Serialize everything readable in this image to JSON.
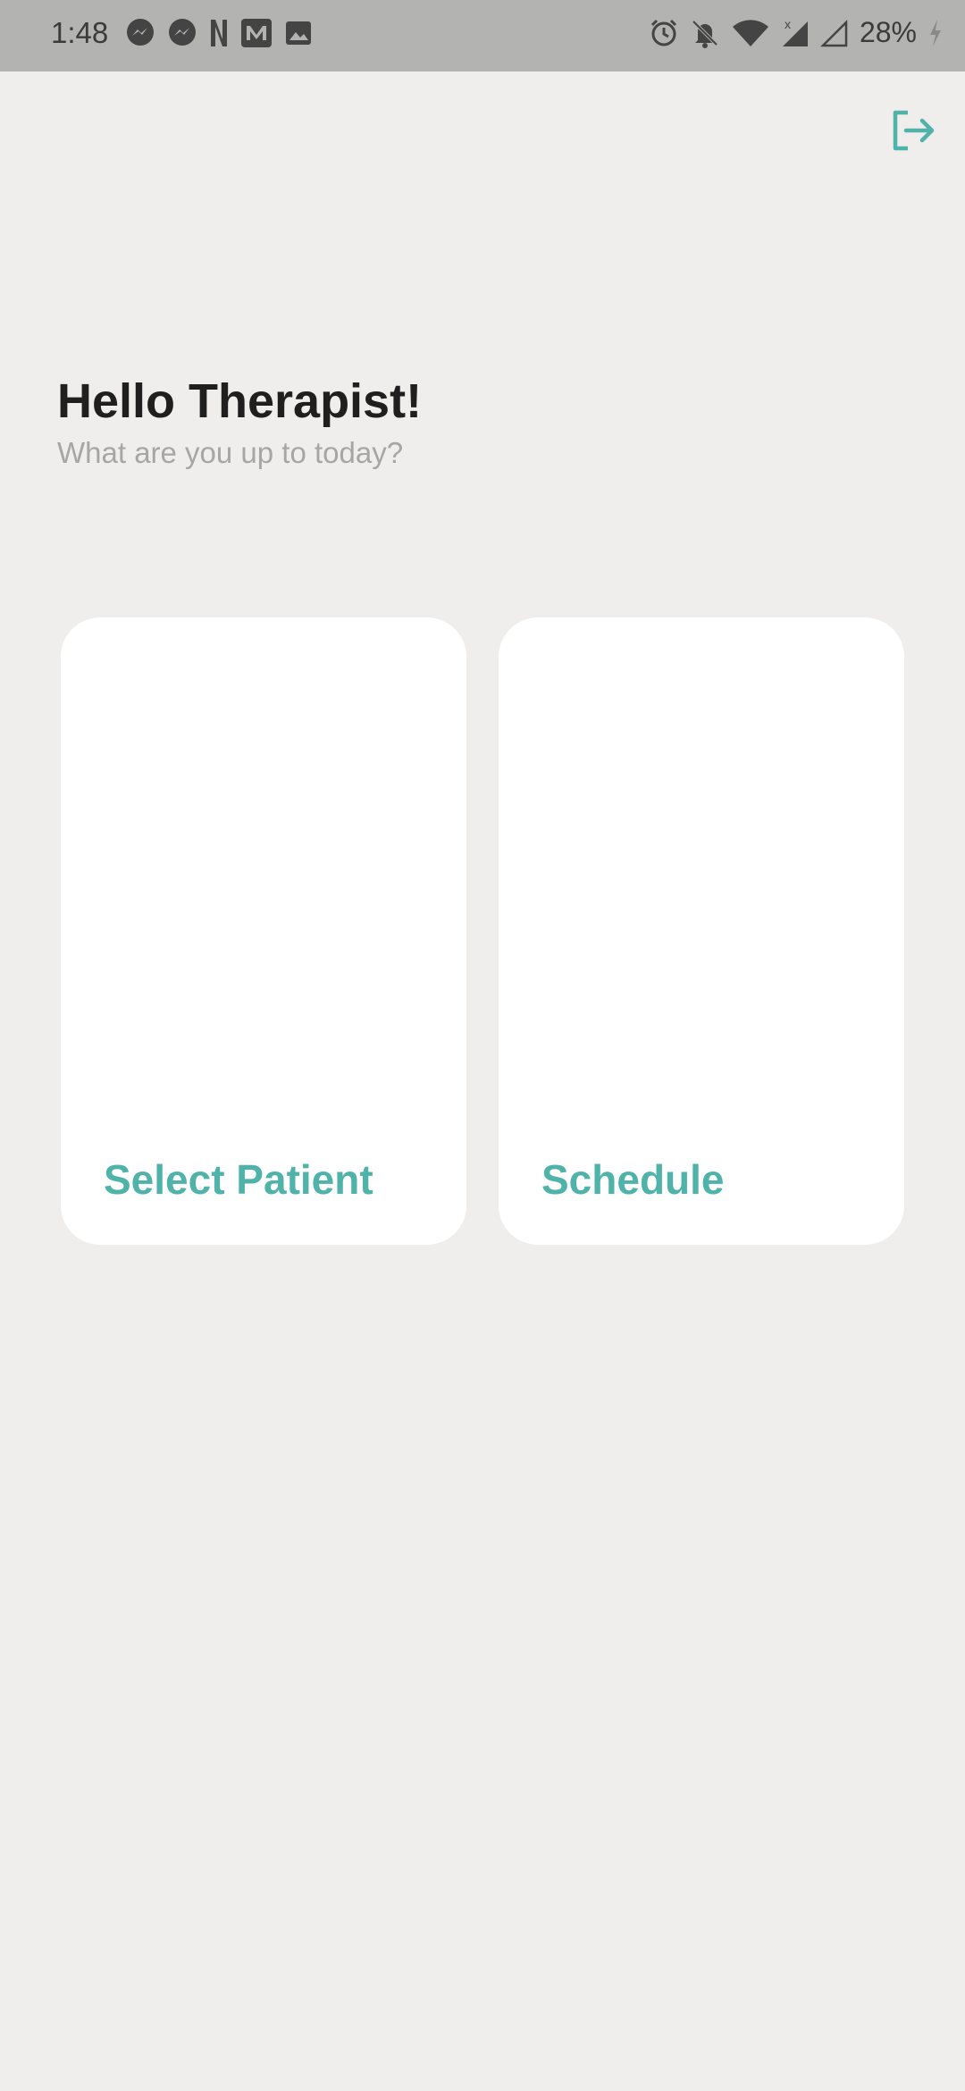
{
  "status_bar": {
    "time": "1:48",
    "battery": "28%",
    "left_icons": [
      "messenger-icon",
      "messenger-icon",
      "netflix-icon",
      "medium-icon",
      "image-icon"
    ],
    "right_icons": [
      "alarm-icon",
      "bell-off-icon",
      "wifi-icon",
      "signal-icon",
      "signal-empty-icon",
      "charging-icon"
    ]
  },
  "header": {
    "logout_icon": "logout-icon"
  },
  "greeting": {
    "title": "Hello Therapist!",
    "subtitle": "What are you up to today?"
  },
  "cards": [
    {
      "label": "Select Patient"
    },
    {
      "label": "Schedule"
    }
  ],
  "colors": {
    "accent": "#4fb3aa",
    "background": "#efeeed",
    "status_bar": "#b3b3b1",
    "card": "#ffffff",
    "title": "#1f1f1f",
    "subtitle": "#a6a6a6"
  }
}
